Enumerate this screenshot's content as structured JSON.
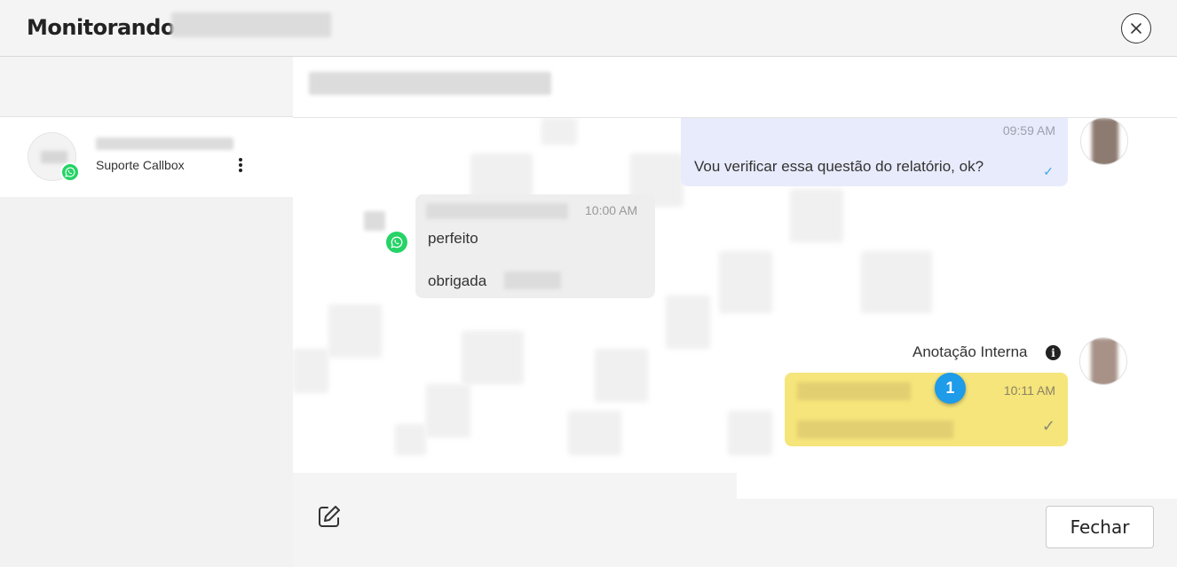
{
  "header": {
    "title": "Monitorando",
    "close_icon": "close-icon"
  },
  "sidebar": {
    "contact": {
      "subtitle": "Suporte Callbox",
      "channel_icon": "whatsapp-icon",
      "menu_icon": "kebab-menu-icon"
    }
  },
  "chat": {
    "messages": [
      {
        "direction": "outgoing",
        "time": "09:59 AM",
        "text": "Vou verificar essa questão do relatório, ok?",
        "status_icon": "double-check-icon"
      },
      {
        "direction": "incoming",
        "time": "10:00 AM",
        "lines": [
          "perfeito",
          "obrigada"
        ],
        "channel_icon": "whatsapp-icon"
      },
      {
        "direction": "internal-note",
        "label": "Anotação Interna",
        "time": "10:11 AM",
        "badge_count": "1",
        "status_icon": "check-icon"
      }
    ]
  },
  "footer": {
    "edit_icon": "edit-icon",
    "close_button_label": "Fechar"
  },
  "colors": {
    "outgoing_bubble": "#e8ebfb",
    "incoming_bubble": "#eeeeee",
    "note_bubble": "#f5e57a",
    "whatsapp_green": "#25d366",
    "badge_blue": "#1e9be9"
  }
}
